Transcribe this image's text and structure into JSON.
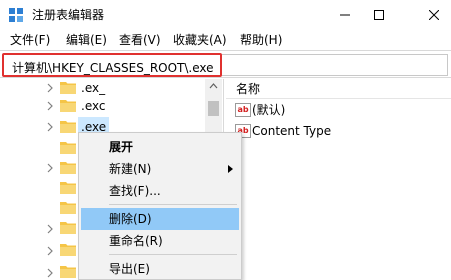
{
  "window": {
    "title": "注册表编辑器"
  },
  "menubar": {
    "items": [
      "文件(F)",
      "编辑(E)",
      "查看(V)",
      "收藏夹(A)",
      "帮助(H)"
    ]
  },
  "address": {
    "value": "计算机\\HKEY_CLASSES_ROOT\\.exe"
  },
  "tree": {
    "items": [
      {
        "label": ".ex_",
        "selected": false
      },
      {
        "label": ".exc",
        "selected": false
      },
      {
        "label": ".exe",
        "selected": true
      }
    ]
  },
  "values_pane": {
    "column_name": "名称",
    "rows": [
      {
        "icon": "ab",
        "name": "(默认)"
      },
      {
        "icon": "ab",
        "name": "Content Type"
      }
    ]
  },
  "context_menu": {
    "items": [
      "展开",
      "新建(N)",
      "查找(F)...",
      "删除(D)",
      "重命名(R)",
      "导出(E)"
    ]
  },
  "colors": {
    "highlight_border": "#e0312f",
    "menu_hover": "#91c9f7",
    "selection": "#cce8ff",
    "folder": "#f5c547"
  }
}
